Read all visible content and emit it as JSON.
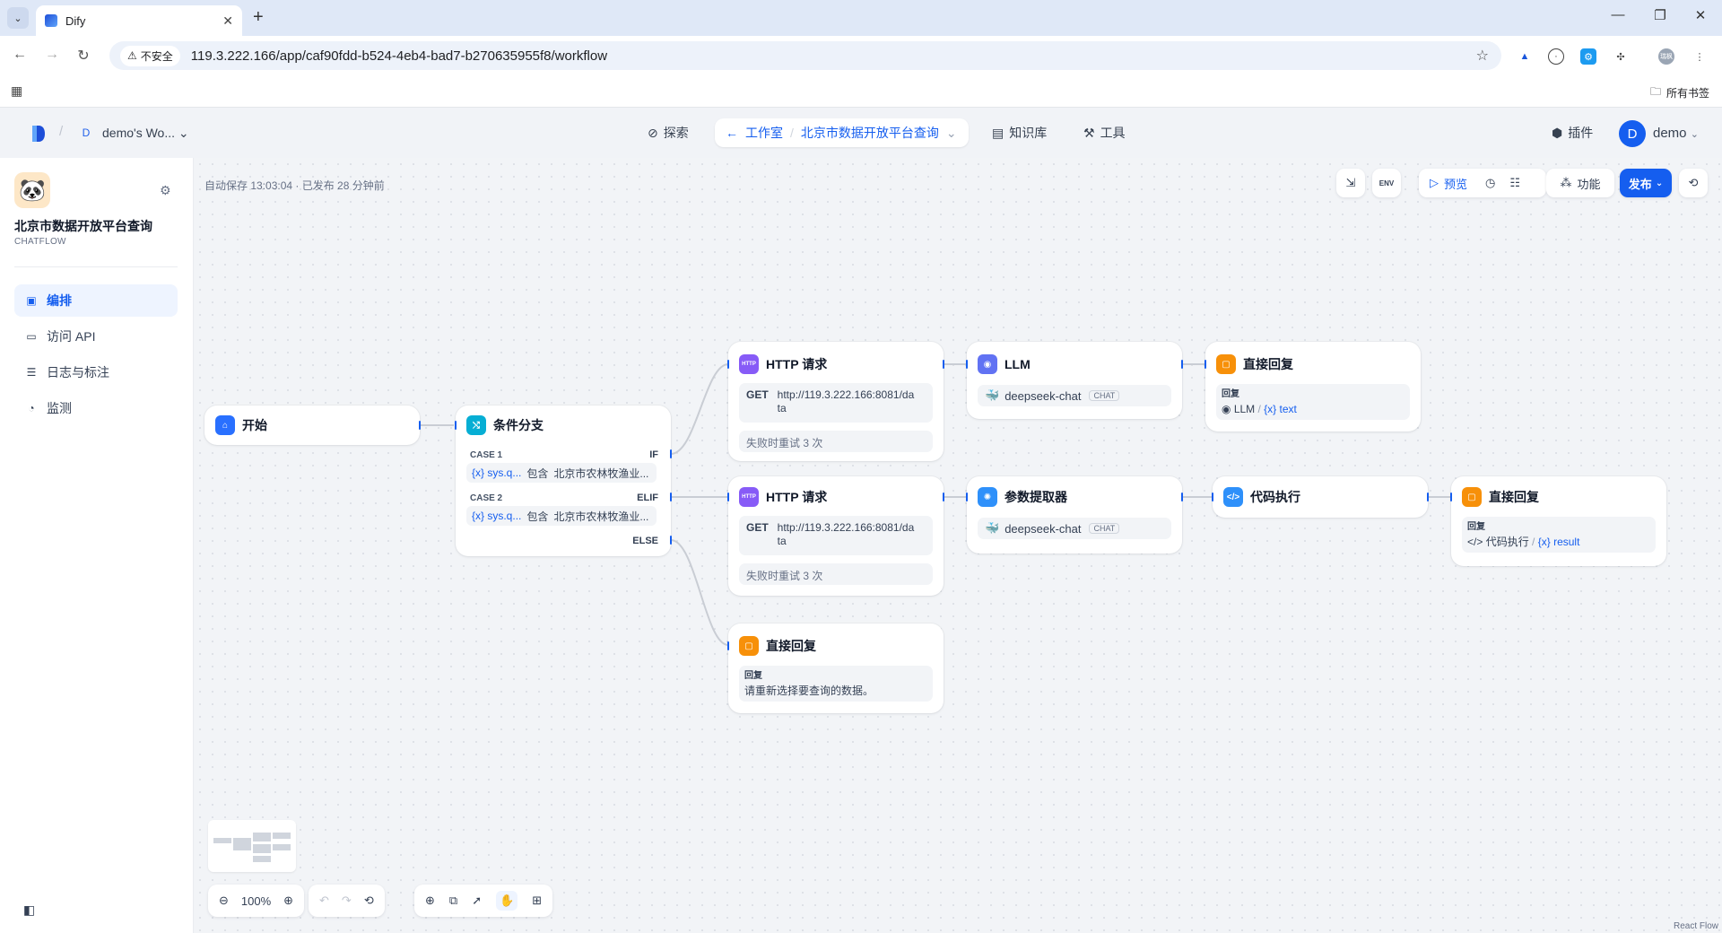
{
  "browser": {
    "tab_title": "Dify",
    "security_label": "不安全",
    "url": "119.3.222.166/app/caf90fdd-b524-4eb4-bad7-b270635955f8/workflow",
    "all_bookmarks": "所有书签",
    "profile_initial": "瑞枫"
  },
  "header": {
    "workspace_initial": "D",
    "workspace_name": "demo's Wo...",
    "nav": {
      "explore": "探索",
      "studio": "工作室",
      "app_name": "北京市数据开放平台查询",
      "knowledge": "知识库",
      "tools": "工具",
      "plugins": "插件"
    },
    "user_initial": "D",
    "user_name": "demo"
  },
  "sidebar": {
    "app_name": "北京市数据开放平台查询",
    "app_type": "CHATFLOW",
    "items": [
      {
        "label": "编排",
        "active": true
      },
      {
        "label": "访问 API",
        "active": false
      },
      {
        "label": "日志与标注",
        "active": false
      },
      {
        "label": "监测",
        "active": false
      }
    ]
  },
  "canvas": {
    "autosave": "自动保存 13:03:04 · 已发布 28 分钟前",
    "toolbar": {
      "env": "ENV",
      "preview": "预览",
      "features": "功能",
      "publish": "发布"
    },
    "zoom": "100%",
    "react_flow": "React Flow"
  },
  "nodes": {
    "start": {
      "title": "开始"
    },
    "if_else": {
      "title": "条件分支",
      "cases": [
        {
          "label": "CASE 1",
          "keyword": "IF",
          "var": "{x} sys.q...",
          "op": "包含",
          "value": "北京市农林牧渔业..."
        },
        {
          "label": "CASE 2",
          "keyword": "ELIF",
          "var": "{x} sys.q...",
          "op": "包含",
          "value": "北京市农林牧渔业..."
        }
      ],
      "else_label": "ELSE"
    },
    "http1": {
      "title": "HTTP 请求",
      "method": "GET",
      "url_line1": "http://119.3.222.166:8081/da",
      "url_line2": "ta",
      "retry": "失败时重试 3 次"
    },
    "http2": {
      "title": "HTTP 请求",
      "method": "GET",
      "url_line1": "http://119.3.222.166:8081/da",
      "url_line2": "ta",
      "retry": "失败时重试 3 次"
    },
    "llm": {
      "title": "LLM",
      "model": "deepseek-chat",
      "mode": "CHAT"
    },
    "answer1": {
      "title": "直接回复",
      "label": "回复",
      "src": "LLM",
      "var": "{x} text"
    },
    "param": {
      "title": "参数提取器",
      "model": "deepseek-chat",
      "mode": "CHAT"
    },
    "code": {
      "title": "代码执行"
    },
    "answer2": {
      "title": "直接回复",
      "label": "回复",
      "src": "代码执行",
      "var": "{x} result"
    },
    "answer3": {
      "title": "直接回复",
      "label": "回复",
      "text": "请重新选择要查询的数据。"
    }
  },
  "colors": {
    "primary": "#155eef",
    "canvas_bg": "#f2f4f7"
  }
}
